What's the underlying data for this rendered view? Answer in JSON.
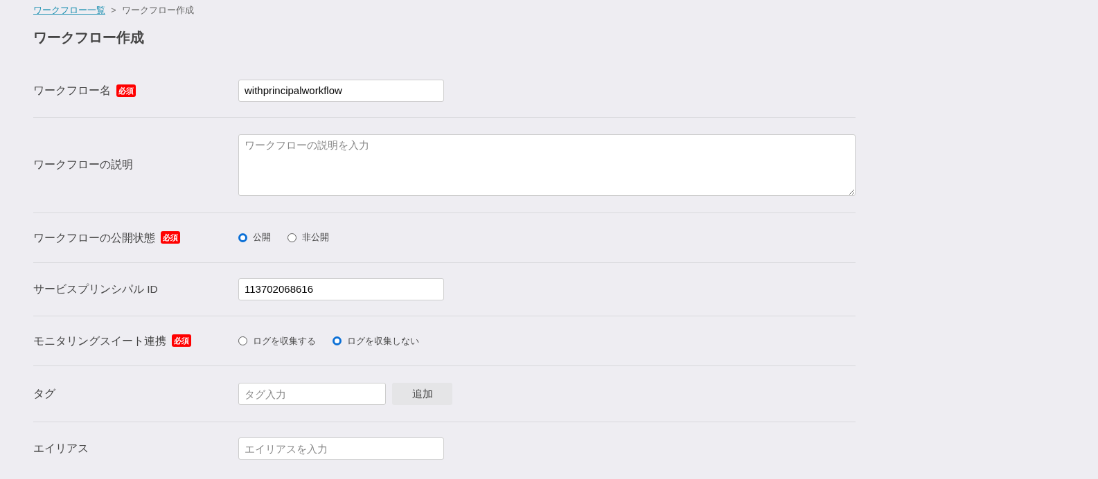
{
  "breadcrumb": {
    "link": "ワークフロー一覧",
    "separator": ">",
    "current": "ワークフロー作成"
  },
  "title": "ワークフロー作成",
  "fields": [
    {
      "kind": "text",
      "label": "ワークフロー名",
      "required": true,
      "badge": "必須",
      "value": "withprincipalworkflow"
    },
    {
      "kind": "textarea",
      "label": "ワークフローの説明",
      "required": false,
      "placeholder": "ワークフローの説明を入力"
    },
    {
      "kind": "radio",
      "label": "ワークフローの公開状態",
      "required": true,
      "badge": "必須",
      "options": [
        {
          "label": "公開",
          "selected": true
        },
        {
          "label": "非公開",
          "selected": false
        }
      ]
    },
    {
      "kind": "text",
      "label": "サービスプリンシパル ID",
      "required": false,
      "value": "113702068616"
    },
    {
      "kind": "radio",
      "label": "モニタリングスイート連携",
      "required": true,
      "badge": "必須",
      "options": [
        {
          "label": "ログを収集する",
          "selected": false
        },
        {
          "label": "ログを収集しない",
          "selected": true
        }
      ]
    },
    {
      "kind": "tag",
      "label": "タグ",
      "required": false,
      "placeholder": "タグ入力",
      "button": "追加"
    },
    {
      "kind": "text",
      "label": "エイリアス",
      "required": false,
      "placeholder": "エイリアスを入力"
    }
  ]
}
